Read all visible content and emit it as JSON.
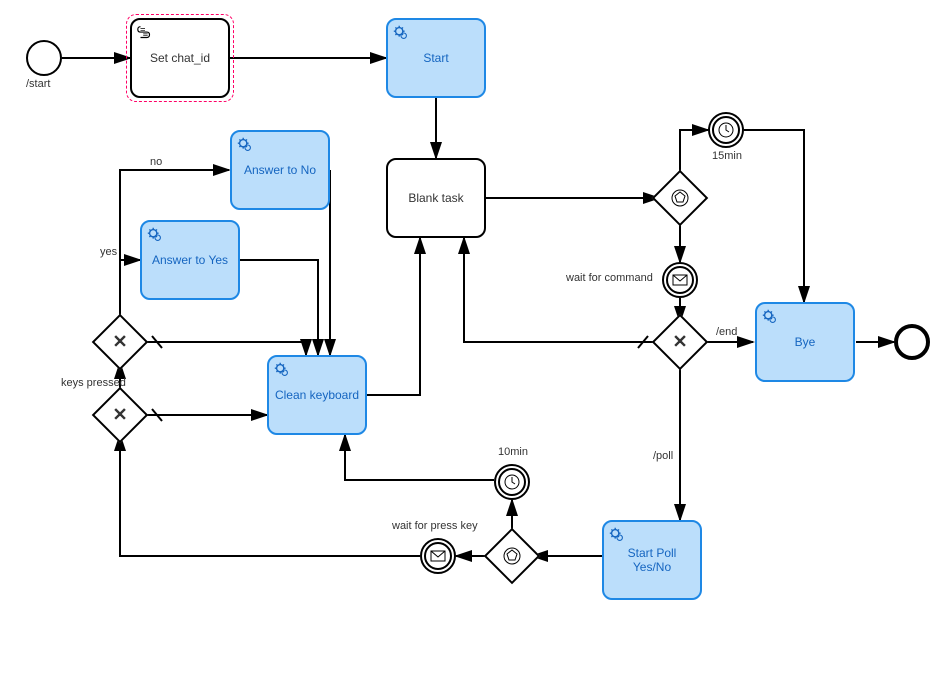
{
  "events": {
    "start_label": "/start"
  },
  "tasks": {
    "set_chat_id": "Set chat_id",
    "start": "Start",
    "answer_no": "Answer to No",
    "answer_yes": "Answer to Yes",
    "blank": "Blank task",
    "clean_keyboard": "Clean keyboard",
    "start_poll": "Start Poll Yes/No",
    "bye": "Bye"
  },
  "intermediate": {
    "fifteen_min": "15min",
    "wait_for_command": "wait for command",
    "ten_min": "10min",
    "wait_for_press_key": "wait for press key"
  },
  "gateways": {
    "keys_pressed": "keys pressed"
  },
  "edges": {
    "no": "no",
    "yes": "yes",
    "end": "/end",
    "poll": "/poll"
  }
}
